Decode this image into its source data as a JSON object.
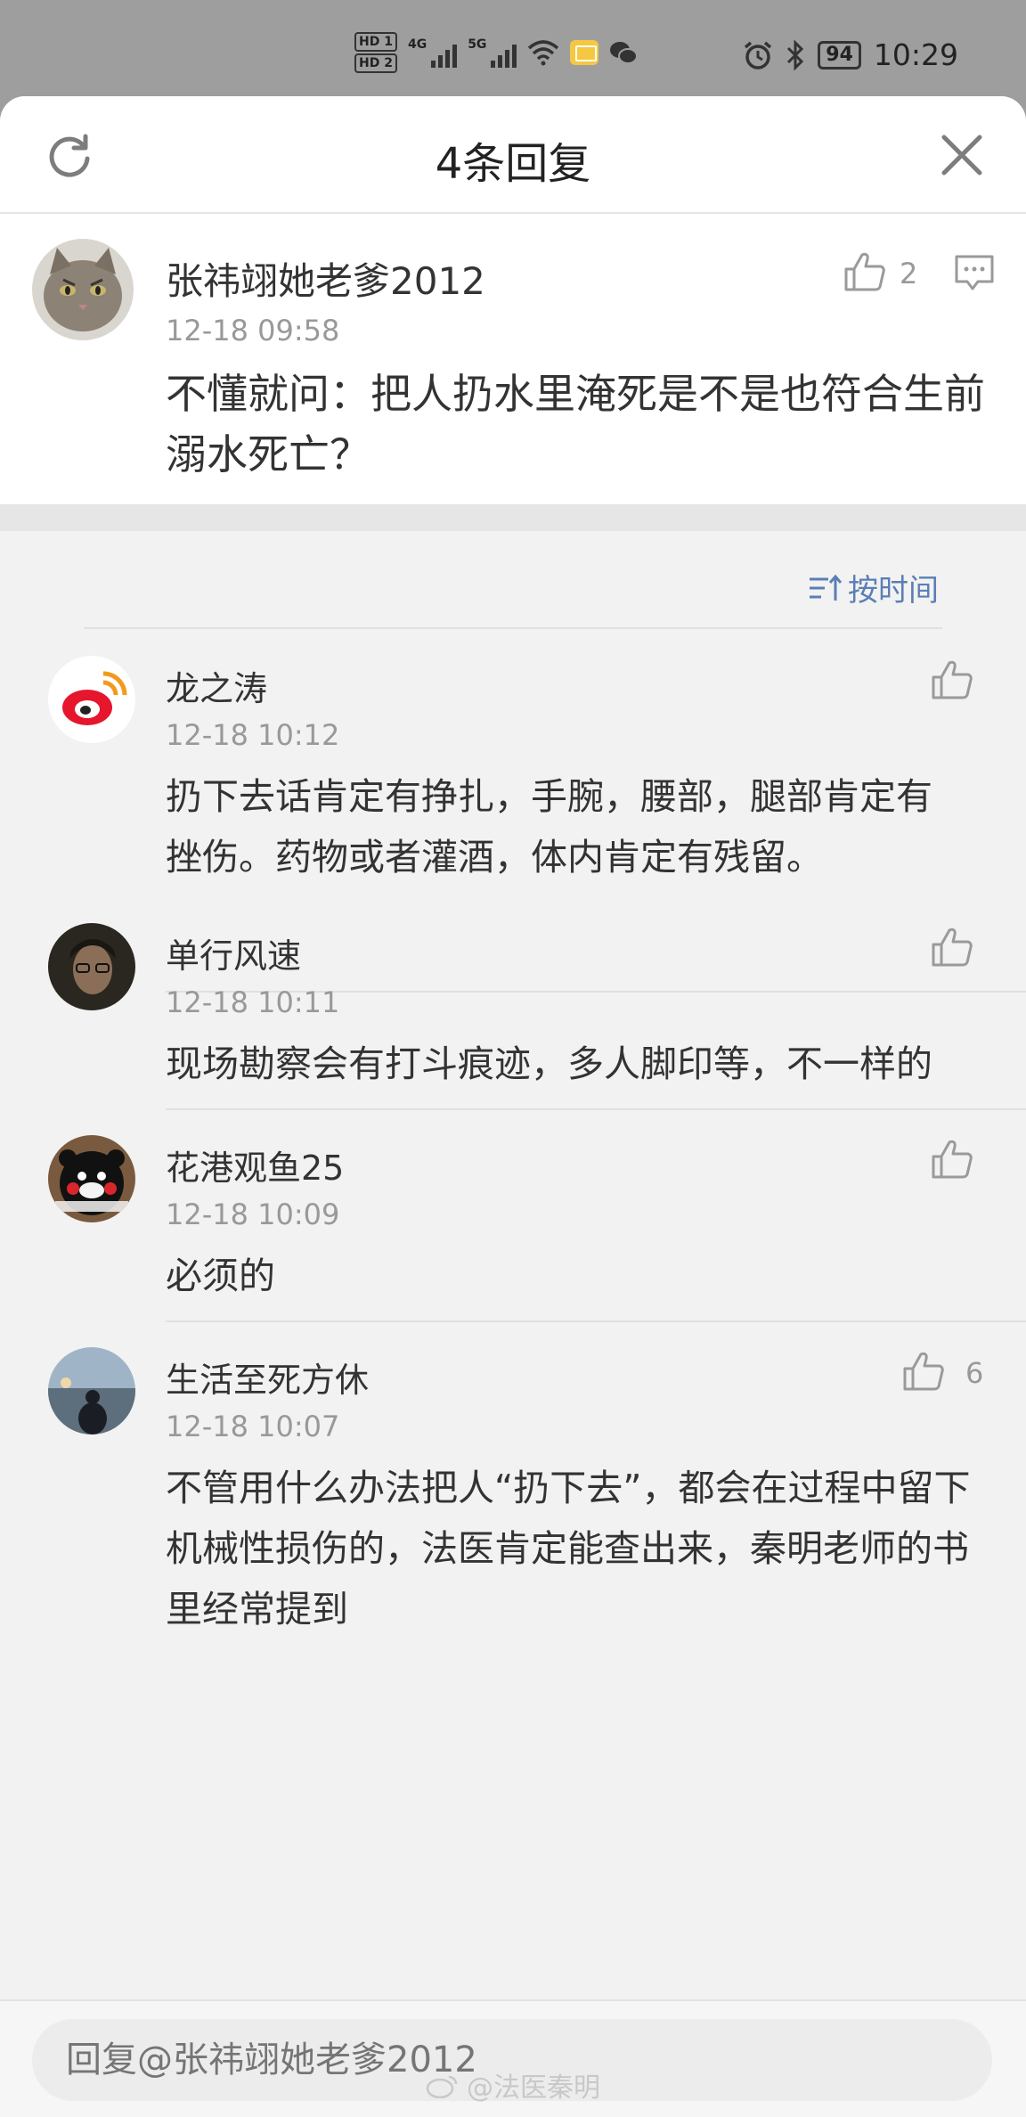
{
  "status_bar": {
    "hd1": "HD 1",
    "hd2": "HD 2",
    "sig1_label": "4G",
    "sig2_label": "5G",
    "battery": "94",
    "time": "10:29"
  },
  "header": {
    "title": "4条回复"
  },
  "main_comment": {
    "user": "张祎翊她老爹2012",
    "time": "12-18 09:58",
    "text": "不懂就问：把人扔水里淹死是不是也符合生前溺水死亡？",
    "likes": "2"
  },
  "sort_label": "按时间",
  "replies": [
    {
      "user": "龙之涛",
      "time": "12-18 10:12",
      "text": "扔下去话肯定有挣扎，手腕，腰部，腿部肯定有挫伤。药物或者灌酒，体内肯定有残留。",
      "likes": ""
    },
    {
      "user": "单行风速",
      "time": "12-18 10:11",
      "text": "现场勘察会有打斗痕迹，多人脚印等，不一样的",
      "likes": ""
    },
    {
      "user": "花港观鱼25",
      "time": "12-18 10:09",
      "text": "必须的",
      "likes": ""
    },
    {
      "user": "生活至死方休",
      "time": "12-18 10:07",
      "text": "不管用什么办法把人“扔下去”，都会在过程中留下机械性损伤的，法医肯定能查出来，秦明老师的书里经常提到",
      "likes": "6"
    }
  ],
  "input": {
    "placeholder": "回复@张祎翊她老爹2012"
  },
  "watermark": "@法医秦明",
  "colors": {
    "accent": "#5b7fb5",
    "muted": "#999999",
    "background": "#f2f2f2"
  }
}
